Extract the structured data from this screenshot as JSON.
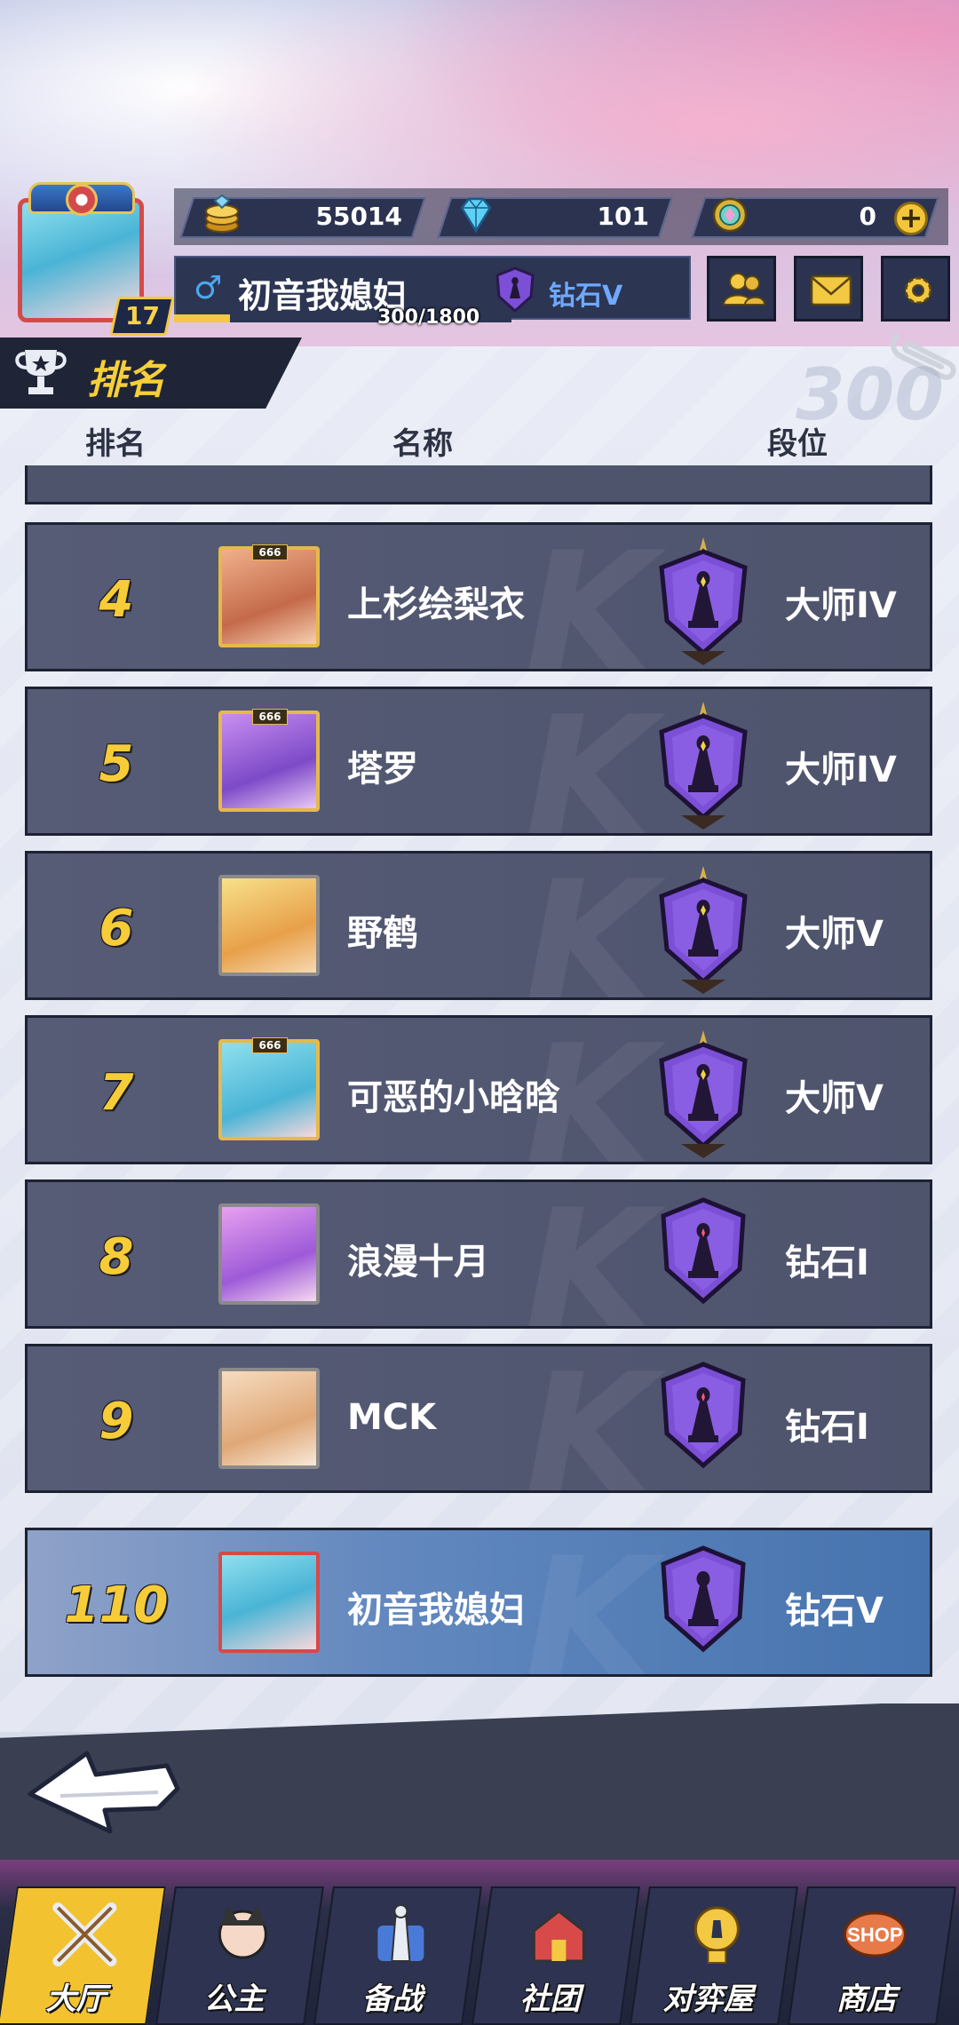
{
  "player": {
    "level": "17",
    "name": "初音我媳妇",
    "gender_symbol": "♂",
    "rank": "钻石V",
    "xp_text": "300/1800",
    "xp_fraction": 0.1667
  },
  "resources": [
    {
      "icon": "gold-coin-stack-icon",
      "value": "55014"
    },
    {
      "icon": "blue-diamond-icon",
      "value": "101"
    },
    {
      "icon": "rainbow-gem-icon",
      "value": "0"
    }
  ],
  "header": {
    "title": "排名",
    "columns": {
      "rank": "排名",
      "name": "名称",
      "tier": "段位"
    },
    "watermark": "300"
  },
  "rows": [
    {
      "rank": "4",
      "name": "上杉绘梨衣",
      "tier": "大师IV",
      "avatar_tag": "666",
      "emblem": "master"
    },
    {
      "rank": "5",
      "name": "塔罗",
      "tier": "大师IV",
      "avatar_tag": "666",
      "emblem": "master"
    },
    {
      "rank": "6",
      "name": "野鹤",
      "tier": "大师V",
      "avatar_tag": "",
      "emblem": "master"
    },
    {
      "rank": "7",
      "name": "可恶的小晗晗",
      "tier": "大师V",
      "avatar_tag": "666",
      "emblem": "master"
    },
    {
      "rank": "8",
      "name": "浪漫十月",
      "tier": "钻石I",
      "avatar_tag": "",
      "emblem": "diamond"
    },
    {
      "rank": "9",
      "name": "MCK",
      "tier": "钻石I",
      "avatar_tag": "",
      "emblem": "diamond"
    }
  ],
  "self_row": {
    "rank": "110",
    "name": "初音我媳妇",
    "tier": "钻石V"
  },
  "nav": [
    {
      "label": "大厅",
      "icon": "crossed-swords-icon",
      "active": true
    },
    {
      "label": "公主",
      "icon": "princess-icon",
      "active": false
    },
    {
      "label": "备战",
      "icon": "chess-pieces-icon",
      "active": false
    },
    {
      "label": "社团",
      "icon": "guild-castle-icon",
      "active": false
    },
    {
      "label": "对弈屋",
      "icon": "golden-chess-trophy-icon",
      "active": false
    },
    {
      "label": "商店",
      "icon": "shop-sign-icon",
      "active": false
    }
  ]
}
